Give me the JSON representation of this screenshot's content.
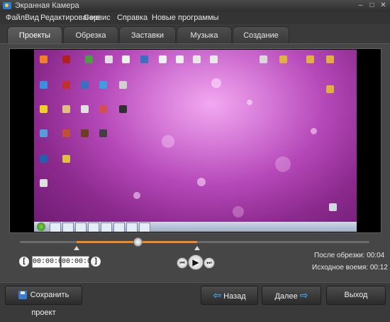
{
  "window": {
    "title": "Экранная Камера",
    "minimize": "–",
    "maximize": "□",
    "close": "✕"
  },
  "menu": [
    "Файл",
    "Вид",
    "Редактирование",
    "Сервис",
    "Справка",
    "Новые программы"
  ],
  "tabs": [
    {
      "label": "Проекты",
      "active": true
    },
    {
      "label": "Обрезка",
      "active": false
    },
    {
      "label": "Заставки",
      "active": false
    },
    {
      "label": "Музыка",
      "active": false
    },
    {
      "label": "Создание видео",
      "active": false
    }
  ],
  "player": {
    "trim_start": "00:00:02",
    "trim_end": "00:00:06",
    "open_bracket_label": "[",
    "close_bracket_label": "]",
    "prev_label": "⏮",
    "play_label": "▶",
    "next_label": "⏭",
    "after_trim": "После обрезки:  00:04",
    "original_time": "Исходное воемя:  00:12"
  },
  "timeline": {
    "playhead_fraction": 0.34,
    "selection_start_fraction": 0.16,
    "selection_end_fraction": 0.5
  },
  "buttons": {
    "save_project": "Сохранить проект",
    "back": "Назад",
    "next": "Далее",
    "exit": "Выход",
    "back_arrow": "⇦",
    "next_arrow": "⇨"
  },
  "colors": {
    "accent": "#f08a24",
    "arrow": "#3aa3ee",
    "panel": "#464646",
    "background": "#3a3a3a"
  }
}
